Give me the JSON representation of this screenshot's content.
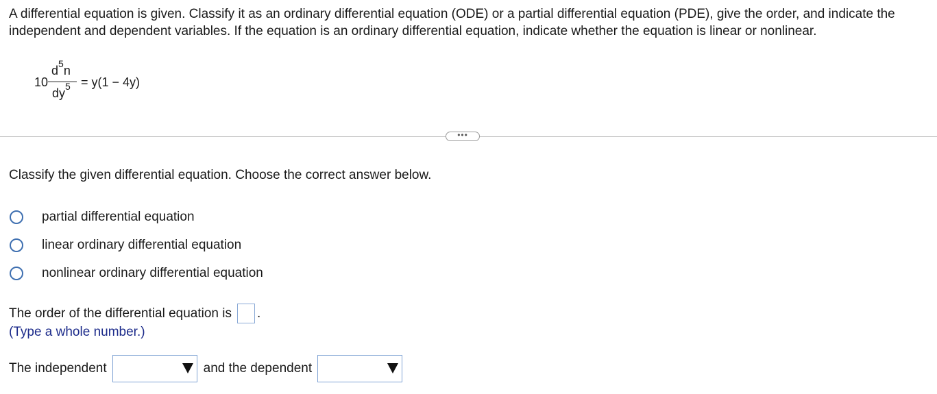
{
  "question": {
    "text": "A differential equation is given. Classify it as an ordinary differential equation (ODE) or a partial differential equation (PDE), give the order, and indicate the independent and dependent variables. If the equation is an ordinary differential equation, indicate whether the equation is linear or nonlinear."
  },
  "equation": {
    "coefficient": "10",
    "numerator_base": "d",
    "numerator_exp": "5",
    "numerator_var": "n",
    "denominator_base": "dy",
    "denominator_exp": "5",
    "rhs": "= y(1 − 4y)"
  },
  "more_button": {
    "label": "•••"
  },
  "prompt": {
    "text": "Classify the given differential equation. Choose the correct answer below."
  },
  "options": [
    {
      "label": "partial differential equation"
    },
    {
      "label": "linear ordinary differential equation"
    },
    {
      "label": "nonlinear ordinary differential equation"
    }
  ],
  "order": {
    "text": "The order of the differential equation is",
    "period": ".",
    "value": "",
    "hint": "(Type a whole number.)"
  },
  "variables": {
    "independent_label": "The independent",
    "and_label": "and the dependent",
    "independent_value": "",
    "dependent_value": ""
  },
  "colors": {
    "radio_border": "#3e6fb0",
    "hint_text": "#1b2a8a",
    "input_border": "#8aa9d6"
  },
  "icons": {
    "radio": "radio-circle-icon",
    "dropdown": "triangle-down-icon"
  }
}
